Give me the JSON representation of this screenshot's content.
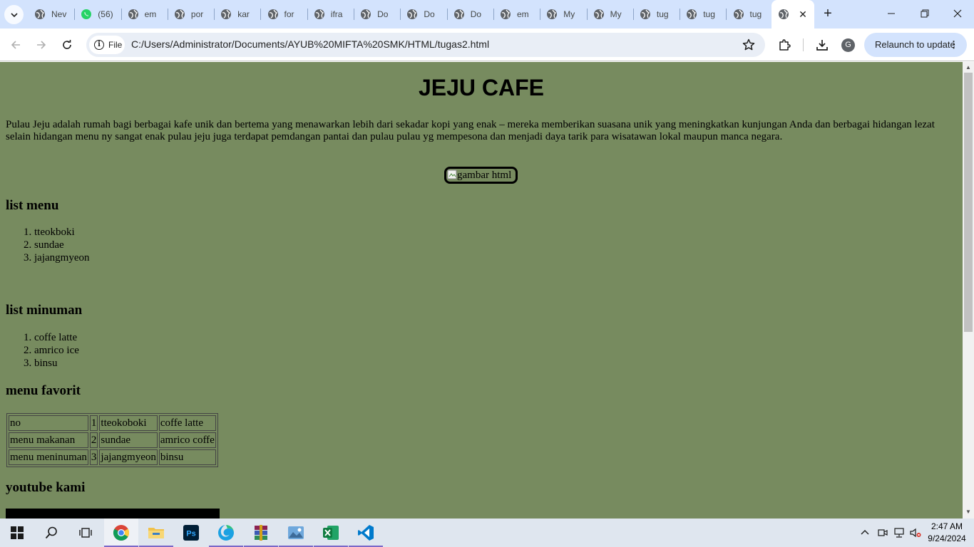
{
  "browser": {
    "tabs": [
      {
        "label": "Nev",
        "icon": "globe-icon"
      },
      {
        "label": "(56)",
        "icon": "whatsapp-icon"
      },
      {
        "label": "em",
        "icon": "globe-icon"
      },
      {
        "label": "por",
        "icon": "globe-icon"
      },
      {
        "label": "kar",
        "icon": "globe-icon"
      },
      {
        "label": "for",
        "icon": "globe-icon"
      },
      {
        "label": "ifra",
        "icon": "globe-icon"
      },
      {
        "label": "Do",
        "icon": "globe-icon"
      },
      {
        "label": "Do",
        "icon": "globe-icon"
      },
      {
        "label": "Do",
        "icon": "globe-icon"
      },
      {
        "label": "em",
        "icon": "globe-icon"
      },
      {
        "label": "My",
        "icon": "globe-icon"
      },
      {
        "label": "My",
        "icon": "globe-icon"
      },
      {
        "label": "tug",
        "icon": "globe-icon"
      },
      {
        "label": "tug",
        "icon": "globe-icon"
      },
      {
        "label": "tug",
        "icon": "globe-icon"
      }
    ],
    "file_chip": "File",
    "url": "C:/Users/Administrator/Documents/AYUB%20MIFTA%20SMK/HTML/tugas2.html",
    "profile_initial": "G",
    "relaunch_label": "Relaunch to update"
  },
  "page": {
    "title": "JEJU CAFE",
    "intro": "Pulau Jeju adalah rumah bagi berbagai kafe unik dan bertema yang menawarkan lebih dari sekadar kopi yang enak – mereka memberikan suasana unik yang meningkatkan kunjungan Anda dan berbagai hidangan lezat selain hidangan menu ny sangat enak pulau jeju juga terdapat pemdangan pantai dan pulau pulau yg mempesona dan menjadi daya tarik para wisatawan lokal maupun manca negara.",
    "image_alt": "gambar html",
    "menu_heading": "list menu",
    "menu_items": [
      "tteokboki",
      "sundae",
      "jajangmyeon"
    ],
    "drinks_heading": "list minuman",
    "drinks_items": [
      "coffe latte",
      "amrico ice",
      "binsu"
    ],
    "favorite_heading": "menu favorit",
    "favorite_table": [
      [
        "no",
        "1",
        "tteokoboki",
        "coffe latte"
      ],
      [
        "menu makanan",
        "2",
        "sundae",
        "amrico coffe"
      ],
      [
        "menu meninuman",
        "3",
        "jajangmyeon",
        "binsu"
      ]
    ],
    "youtube_heading": "youtube kami",
    "background_color": "#778b5f"
  },
  "taskbar": {
    "apps": [
      "start-icon",
      "search-icon",
      "task-view-icon",
      "chrome-icon",
      "file-explorer-icon",
      "photoshop-icon",
      "edge-icon",
      "winrar-icon",
      "photos-icon",
      "excel-icon",
      "vscode-icon"
    ],
    "time": "2:47 AM",
    "date": "9/24/2024"
  }
}
